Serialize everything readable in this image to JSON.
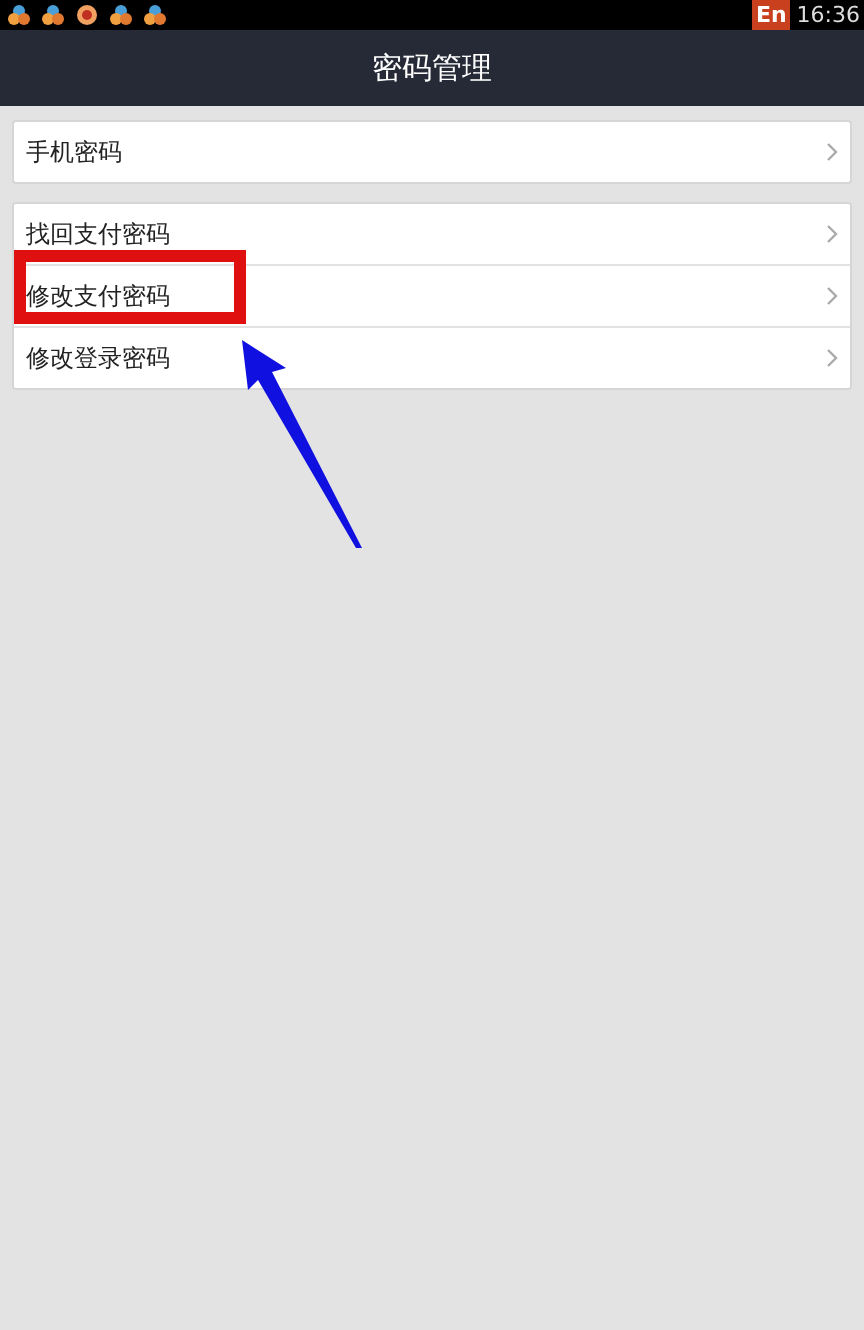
{
  "status_bar": {
    "keyboard": "En",
    "time": "16:36"
  },
  "header": {
    "title": "密码管理"
  },
  "groups": [
    {
      "items": [
        {
          "label": "手机密码",
          "highlighted": false
        }
      ]
    },
    {
      "items": [
        {
          "label": "找回支付密码",
          "highlighted": false
        },
        {
          "label": "修改支付密码",
          "highlighted": true
        },
        {
          "label": "修改登录密码",
          "highlighted": false
        }
      ]
    }
  ]
}
